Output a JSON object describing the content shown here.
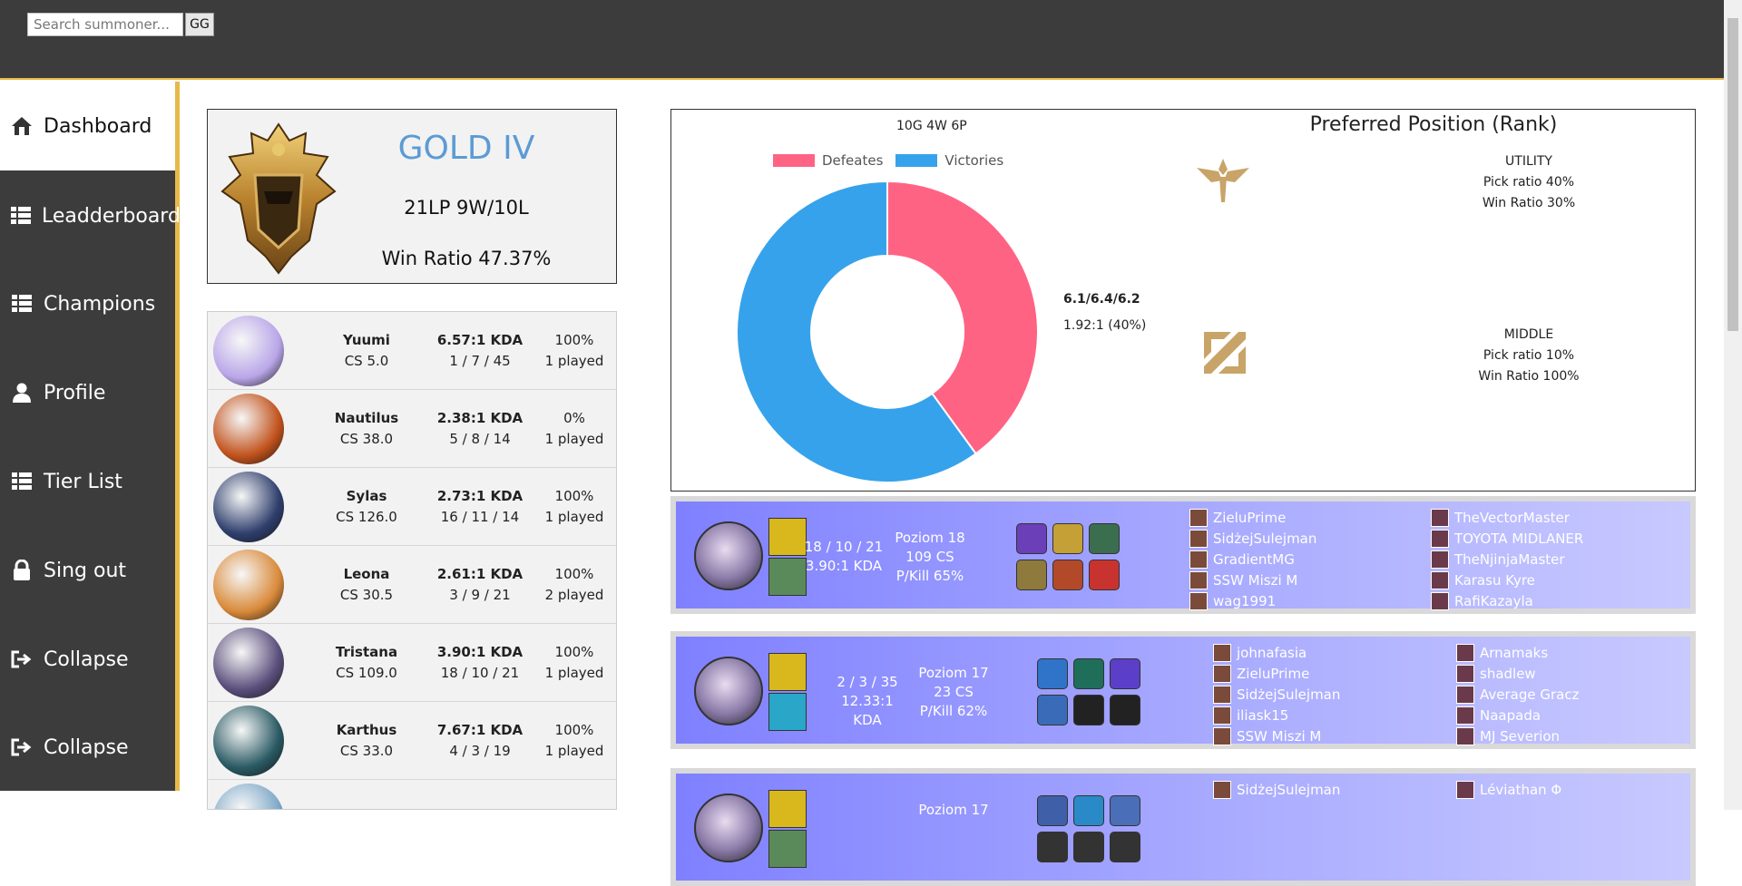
{
  "search": {
    "placeholder": "Search summoner...",
    "button_label": "GG"
  },
  "sidebar": {
    "items": [
      {
        "label": "Dashboard",
        "icon": "home-icon"
      },
      {
        "label": "Leadderboard",
        "icon": "table-icon"
      },
      {
        "label": "Champions",
        "icon": "table-icon"
      },
      {
        "label": "Profile",
        "icon": "user-icon"
      },
      {
        "label": "Tier List",
        "icon": "table-icon"
      },
      {
        "label": "Sing out",
        "icon": "lock-icon"
      },
      {
        "label": "Collapse",
        "icon": "signout-icon"
      },
      {
        "label": "Collapse",
        "icon": "signout-icon"
      }
    ],
    "accent": "#e8b84a"
  },
  "rank": {
    "tier": "GOLD IV",
    "lp_record": "21LP 9W/10L",
    "win_ratio": "Win Ratio 47.37%",
    "tier_color": "#5b9bd5"
  },
  "champions": [
    {
      "name": "Yuumi",
      "cs": "CS 5.0",
      "kda": "6.57:1 KDA",
      "kills": "1 / 7 / 45",
      "winrate": "100%",
      "played": "1 played",
      "color": "#b9a6e8"
    },
    {
      "name": "Nautilus",
      "cs": "CS 38.0",
      "kda": "2.38:1 KDA",
      "kills": "5 / 8 / 14",
      "winrate": "0%",
      "played": "1 played",
      "color": "#c2531d"
    },
    {
      "name": "Sylas",
      "cs": "CS 126.0",
      "kda": "2.73:1 KDA",
      "kills": "16 / 11 / 14",
      "winrate": "100%",
      "played": "1 played",
      "color": "#2f3f6d"
    },
    {
      "name": "Leona",
      "cs": "CS 30.5",
      "kda": "2.61:1 KDA",
      "kills": "3 / 9 / 21",
      "winrate": "100%",
      "played": "2 played",
      "color": "#d98a3a"
    },
    {
      "name": "Tristana",
      "cs": "CS 109.0",
      "kda": "3.90:1 KDA",
      "kills": "18 / 10 / 21",
      "winrate": "100%",
      "played": "1 played",
      "color": "#5a4f7c"
    },
    {
      "name": "Karthus",
      "cs": "CS 33.0",
      "kda": "7.67:1 KDA",
      "kills": "4 / 3 / 19",
      "winrate": "100%",
      "played": "1 played",
      "color": "#2a5a64"
    }
  ],
  "chart_data": {
    "type": "pie",
    "title": "10G 4W 6P",
    "categories": [
      "Defeates",
      "Victories"
    ],
    "values": [
      4,
      6
    ],
    "colors": [
      "#ff6384",
      "#36a2eb"
    ],
    "legend": "top"
  },
  "summary": {
    "kda_avg": "6.1/6.4/6.2",
    "kda_ratio": "1.92:1 (40%)"
  },
  "positions": {
    "title": "Preferred Position (Rank)",
    "items": [
      {
        "role": "UTILITY",
        "pick": "Pick ratio 40%",
        "win": "Win Ratio 30%",
        "icon": "support-icon"
      },
      {
        "role": "MIDDLE",
        "pick": "Pick ratio 10%",
        "win": "Win Ratio 100%",
        "icon": "middle-icon"
      }
    ]
  },
  "matches": [
    {
      "kda_line": "18 / 10 / 21",
      "kda_ratio": "3.90:1 KDA",
      "level": "Poziom 18",
      "cs": "109 CS",
      "pkill": "P/Kill 65%",
      "team1": [
        "ZieluPrime",
        "SidżejSulejman",
        "GradientMG",
        "SSW Miszi M",
        "wag1991"
      ],
      "team2": [
        "TheVectorMaster",
        "TOYOTA MIDLANER",
        "TheNjinjaMaster",
        "Karasu Kyre",
        "RafiKazayla"
      ]
    },
    {
      "kda_line": "2 / 3 / 35",
      "kda_ratio": "12.33:1 KDA",
      "level": "Poziom 17",
      "cs": "23 CS",
      "pkill": "P/Kill 62%",
      "team1": [
        "johnafasia",
        "ZieluPrime",
        "SidżejSulejman",
        "iliask15",
        "SSW Miszi M"
      ],
      "team2": [
        "Arnamaks",
        "shadlew",
        "Average Gracz",
        "Naapada",
        "MJ Severion"
      ]
    },
    {
      "kda_line": "",
      "kda_ratio": "",
      "level": "Poziom 17",
      "cs": "",
      "pkill": "",
      "team1": [
        "SidżejSulejman"
      ],
      "team2": [
        "Léviathan Φ"
      ]
    }
  ]
}
